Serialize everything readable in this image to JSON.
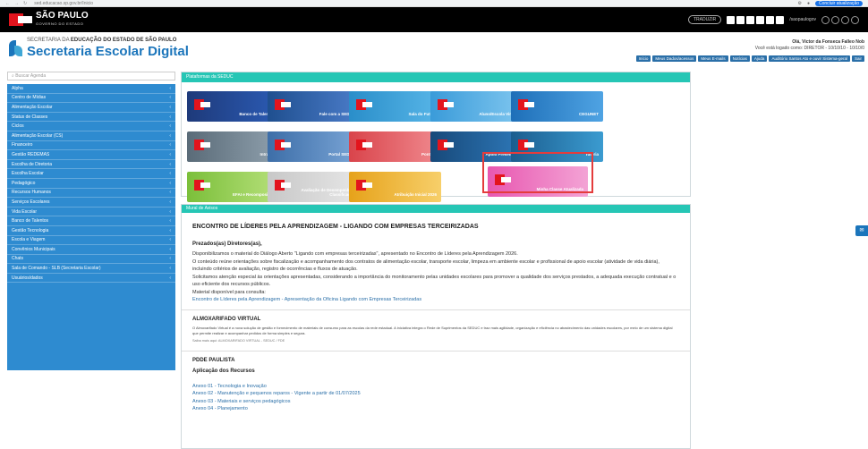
{
  "browser": {
    "url": "sed.educacao.sp.gov.br/Inicio",
    "profile_button": "Concluir atualização"
  },
  "topbar": {
    "brand": "SÃO PAULO",
    "brand_sub": "GOVERNO DO ESTADO",
    "pill": "TRADUZIR",
    "gov_text": "/saopaulogov"
  },
  "header": {
    "dept_line_prefix": "SECRETARIA DA",
    "dept_line_bold": "EDUCAÇÃO DO ESTADO DE SÃO PAULO",
    "app_title": "Secretaria Escolar Digital",
    "user_name": "Olá, Victor da Fonseca Falleo Nob",
    "user_line2": "Você está logado como: DIRETOR - 10/10/10 - 10/10/0",
    "buttons": [
      "Início",
      "Meus Dados/acessos",
      "Meus E-mails",
      "Notícias",
      "Ajuda",
      "Auditório Santos Ato e ouvir Sistema-geral",
      "Sair"
    ]
  },
  "sidebar": {
    "search_placeholder": "Buscar Agenda",
    "items": [
      {
        "label": "Alpha"
      },
      {
        "label": "Centro de Mídias"
      },
      {
        "label": "Alimentação Escolar"
      },
      {
        "label": "Status de Classes"
      },
      {
        "label": "Ciclos"
      },
      {
        "label": "Alimentação Escolar (CS)"
      },
      {
        "label": "Financeiro"
      },
      {
        "label": "Gestão REDEMAS"
      },
      {
        "label": "Escolha de Diretoria"
      },
      {
        "label": "Escolha Escolar"
      },
      {
        "label": "Pedagógico"
      },
      {
        "label": "Recursos Humanos"
      },
      {
        "label": "Serviços Escolares"
      },
      {
        "label": "Vida Escolar"
      },
      {
        "label": "Banco de Talentos"
      },
      {
        "label": "Gestão Tecnologia"
      },
      {
        "label": "Escola e Viagem"
      },
      {
        "label": "Convênios Municipais"
      },
      {
        "label": "Chats"
      },
      {
        "label": "Sala de Comando - SLB (Secretaria Escolar)"
      },
      {
        "label": "Usuários/dados"
      }
    ]
  },
  "platforms_panel": {
    "title": "Plataformas da SEDUC",
    "tiles": [
      {
        "label": "Banco de Talentos",
        "colors": [
          "#1e3a7a",
          "#2b5bb4"
        ]
      },
      {
        "label": "Fale com a SEDUC",
        "colors": [
          "#1f4f8f",
          "#4b7cc9"
        ]
      },
      {
        "label": "Sala do Futuro",
        "colors": [
          "#2a8ec9",
          "#58b6e8"
        ]
      },
      {
        "label": "Aluno/Escola Virtual",
        "colors": [
          "#3a9bd9",
          "#7fc6ef"
        ]
      },
      {
        "label": "CEGUNET",
        "colors": [
          "#1e6fb8",
          "#4fa3e3"
        ]
      },
      {
        "label": "Intranet",
        "colors": [
          "#5a6b78",
          "#8fa0ad"
        ]
      },
      {
        "label": "Portal SEDUC",
        "colors": [
          "#3d6ea8",
          "#7aa5d6"
        ]
      },
      {
        "label": "Pontuar",
        "colors": [
          "#d9444b",
          "#f08a8f"
        ]
      },
      {
        "label": "Apoio Presencial",
        "colors": [
          "#17497a",
          "#2e78b8"
        ]
      },
      {
        "label": "Tutoria",
        "colors": [
          "#1b5d8f",
          "#3b9bd0"
        ]
      },
      {
        "label": "EFAI e Recomposição",
        "colors": [
          "#7bbf3a",
          "#b6e07a"
        ]
      },
      {
        "label": "Avaliação de Desempenho e Classificação",
        "colors": [
          "#c8c8c8",
          "#e6e6e6"
        ]
      },
      {
        "label": "Atribuição Inicial 2026",
        "colors": [
          "#e6a21a",
          "#f7cf6a"
        ]
      },
      {
        "label": "Minha Classe Atualizada",
        "colors": [
          "#e857b0",
          "#f3a3d5"
        ]
      }
    ]
  },
  "news_panel": {
    "title": "Mural de Avisos",
    "headline": "ENCONTRO DE LÍDERES PELA APRENDIZAGEM - LIGANDO COM EMPRESAS TERCEIRIZADAS",
    "greeting": "Prezados(as) Diretores(as),",
    "p1": "Disponibilizamos o material do Diálogo Aberto \"Ligando com empresas terceirizadas\", apresentado no Encontro de Líderes pela Aprendizagem 2026.",
    "p2": "O conteúdo reúne orientações sobre fiscalização e acompanhamento dos contratos de alimentação escolar, transporte escolar, limpeza em ambiente escolar e profissional de apoio escolar (atividade de vida diária), incluindo critérios de avaliação, registro de ocorrências e fluxos de atuação.",
    "p3": "Solicitamos atenção especial às orientações apresentadas, considerando a importância do monitoramento pelas unidades escolares para promover a qualidade dos serviços prestados, a adequada execução contratual e o uso eficiente dos recursos públicos.",
    "p4": "Material disponível para consulta:",
    "link1": "Encontro de Líderes pela Aprendizagem - Apresentação da Oficina Ligando com Empresas Terceirizadas",
    "h2": "ALMOXARIFADO VIRTUAL",
    "almox_text": "O Almoxarifado Virtual é a nova solução de gestão e fornecimento de materiais de consumo para as escolas da rede estadual. A iniciativa integra o Rede de Suprimentos da SEDUC e traz mais agilidade, organização e eficiência no abastecimento das unidades escolares, por meio de um sistema digital que permite realizar e acompanhar pedidos de forma simples e segura.",
    "almox_link": "Saiba mais aqui: ALMOXARIFADO VIRTUAL - SEDUC / FDE",
    "h3": "PDDE PAULISTA",
    "h3_sub": "Aplicação dos Recursos",
    "links": [
      "Anexo 01 - Tecnologia e Inovação",
      "Anexo 02 - Manutenção e pequenos reparos - Vigente a partir de 01/07/2025",
      "Anexo 03 - Materiais e serviços pedagógicos",
      "Anexo 04 - Planejamento"
    ]
  },
  "float_button": "Ajuda"
}
